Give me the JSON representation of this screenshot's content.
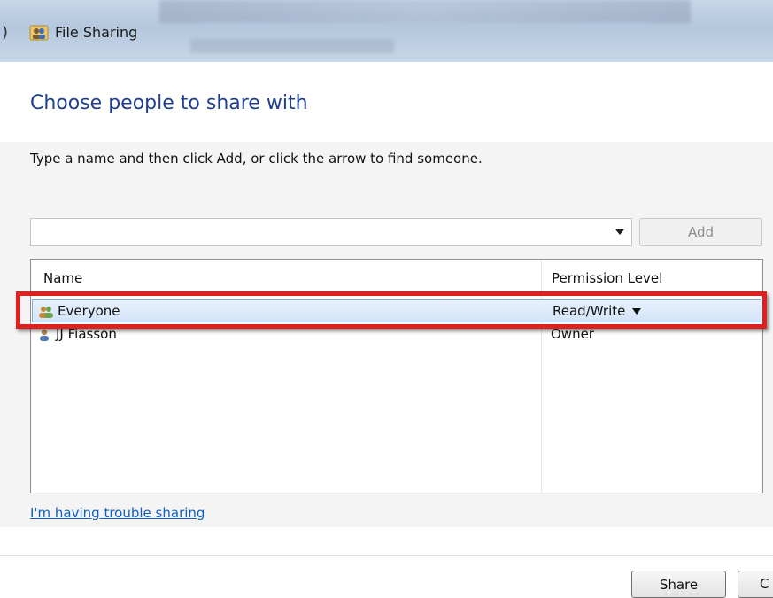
{
  "window": {
    "title": "File Sharing",
    "app_icon": "file-sharing-people-icon"
  },
  "dialog": {
    "heading": "Choose people to share with",
    "instruction": "Type a name and then click Add, or click the arrow to find someone."
  },
  "name_entry": {
    "value": "",
    "placeholder": "",
    "add_label": "Add"
  },
  "share_list": {
    "columns": [
      "Name",
      "Permission Level"
    ],
    "rows": [
      {
        "name": "Everyone",
        "permission": "Read/Write",
        "icon": "group-users-icon",
        "selected": true,
        "has_dropdown": true
      },
      {
        "name": "JJ Fiasson",
        "permission": "Owner",
        "icon": "single-user-icon",
        "selected": false,
        "has_dropdown": false
      }
    ]
  },
  "help_link": "I'm having trouble sharing",
  "footer": {
    "share_label": "Share",
    "cancel_label": "C"
  },
  "colors": {
    "heading": "#1e3e8f",
    "link": "#0f5ec2",
    "highlight": "#e01f1f",
    "selection": "#d3e4f8"
  }
}
